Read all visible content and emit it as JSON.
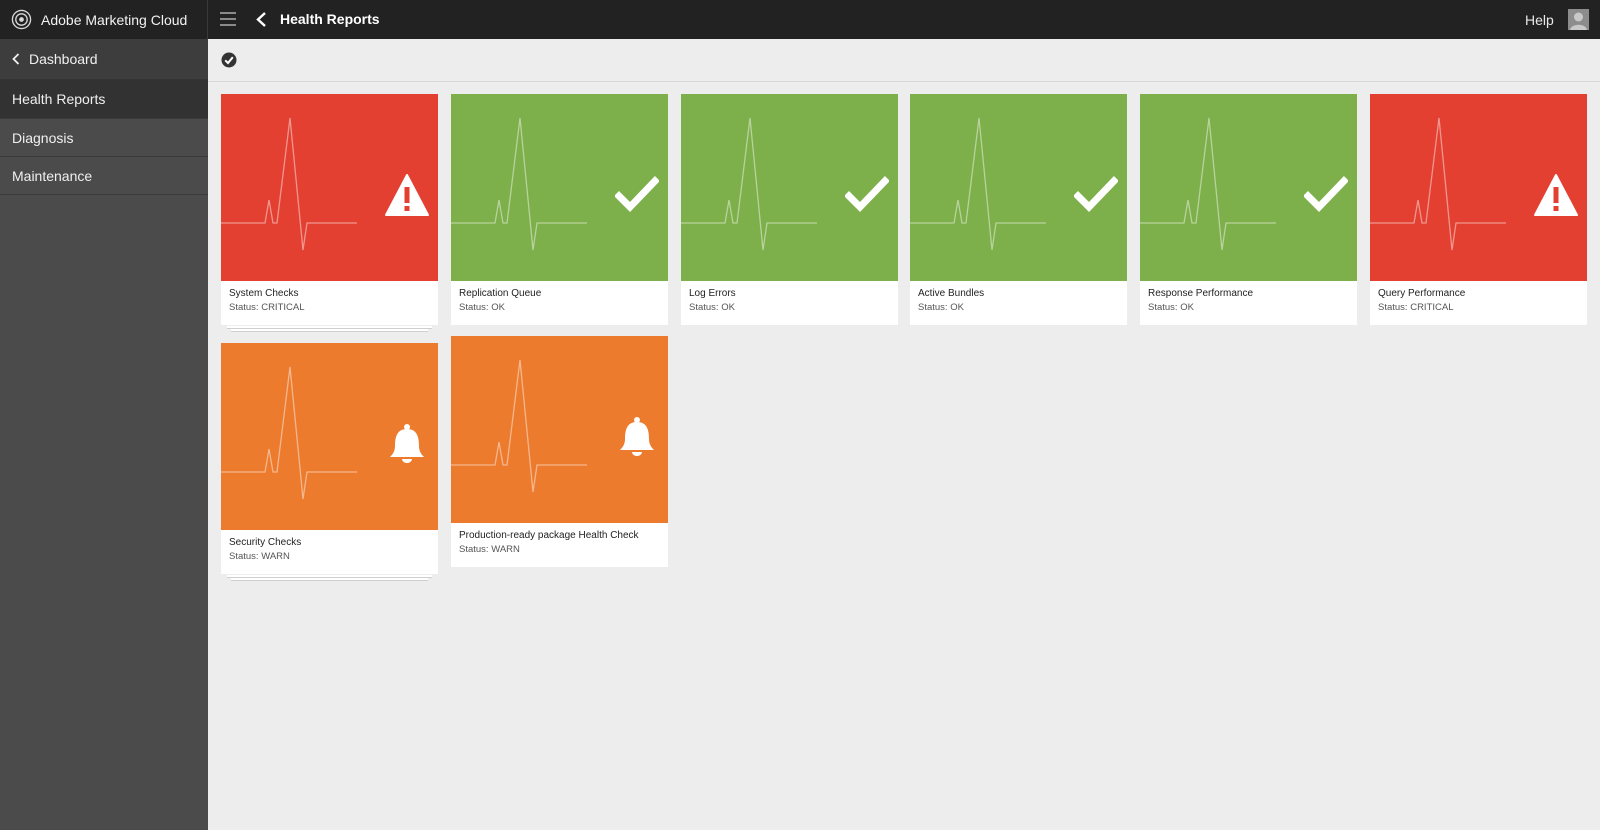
{
  "app": {
    "brand_name": "Adobe Marketing Cloud",
    "page_title": "Health Reports",
    "help_label": "Help"
  },
  "sidebar": {
    "back_label": "Dashboard",
    "items": [
      {
        "label": "Health Reports",
        "active": true
      },
      {
        "label": "Diagnosis",
        "active": false
      },
      {
        "label": "Maintenance",
        "active": false
      }
    ]
  },
  "colors": {
    "critical": "#e34032",
    "ok": "#7daf4a",
    "warn": "#ec7b2e",
    "topbar": "#222222",
    "sidebar": "#4b4b4b"
  },
  "cards": [
    {
      "title": "System Checks",
      "status": "Status: CRITICAL",
      "level": "critical",
      "icon": "warning-icon"
    },
    {
      "title": "Replication Queue",
      "status": "Status: OK",
      "level": "ok",
      "icon": "checkmark-icon"
    },
    {
      "title": "Log Errors",
      "status": "Status: OK",
      "level": "ok",
      "icon": "checkmark-icon"
    },
    {
      "title": "Active Bundles",
      "status": "Status: OK",
      "level": "ok",
      "icon": "checkmark-icon"
    },
    {
      "title": "Response Performance",
      "status": "Status: OK",
      "level": "ok",
      "icon": "checkmark-icon"
    },
    {
      "title": "Query Performance",
      "status": "Status: CRITICAL",
      "level": "critical",
      "icon": "warning-icon"
    },
    {
      "title": "Security Checks",
      "status": "Status: WARN",
      "level": "warn",
      "icon": "bell-icon"
    },
    {
      "title": "Production-ready package Health Check",
      "status": "Status: WARN",
      "level": "warn",
      "icon": "bell-icon"
    }
  ]
}
